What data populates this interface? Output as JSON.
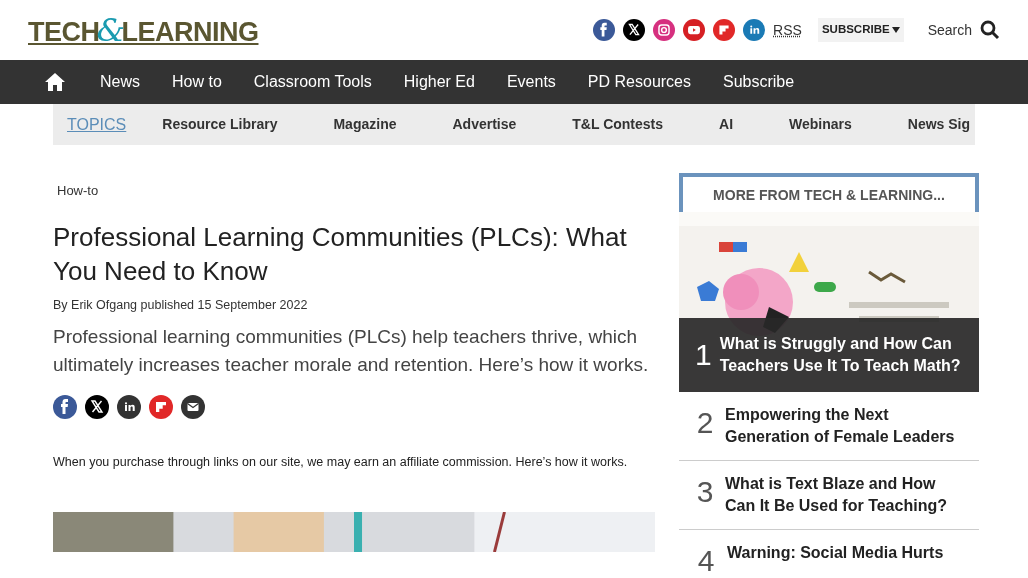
{
  "header": {
    "logo": {
      "part1": "TECH",
      "amp": "&",
      "part2": "LEARNING"
    },
    "social": [
      {
        "kind": "facebook"
      },
      {
        "kind": "x"
      },
      {
        "kind": "instagram"
      },
      {
        "kind": "youtube"
      },
      {
        "kind": "flipboard"
      },
      {
        "kind": "linkedin"
      }
    ],
    "rss": "RSS",
    "subscribe": "SUBSCRIBE",
    "search": "Search"
  },
  "nav": {
    "items": [
      "News",
      "How to",
      "Classroom Tools",
      "Higher Ed",
      "Events",
      "PD Resources",
      "Subscribe"
    ]
  },
  "topics": {
    "label": "TOPICS",
    "items": [
      "Resource Library",
      "Magazine",
      "Advertise",
      "T&L Contests",
      "AI",
      "Webinars",
      "News Sig"
    ]
  },
  "article": {
    "breadcrumb": "How-to",
    "title": "Professional Learning Communities (PLCs): What You Need to Know",
    "byline": {
      "by": "By",
      "author": "Erik Ofgang",
      "published": "published 15 September 2022"
    },
    "standfirst": "Professional learning communities (PLCs) help teachers thrive, which ultimately increases teacher morale and retention. Here’s how it works.",
    "share": [
      {
        "kind": "facebook"
      },
      {
        "kind": "x"
      },
      {
        "kind": "linkedin"
      },
      {
        "kind": "flipboard"
      },
      {
        "kind": "email"
      }
    ],
    "affiliate": {
      "text": "When you purchase through links on our site, we may earn an affiliate commission.",
      "link": "Here’s how it works",
      "end": "."
    }
  },
  "sidebar": {
    "title": "MORE FROM TECH & LEARNING...",
    "items": [
      {
        "rank": "1",
        "title": "What is Struggly and How Can Teachers Use It To Teach Math?",
        "kind": "featured"
      },
      {
        "rank": "2",
        "title": "Empowering the Next Generation of Female Leaders",
        "kind": "plain"
      },
      {
        "rank": "3",
        "title": "What is Text Blaze and How Can It Be Used for Teaching?",
        "kind": "plain"
      },
      {
        "rank": "4",
        "title": "Warning: Social Media Hurts",
        "kind": "plain"
      }
    ]
  }
}
